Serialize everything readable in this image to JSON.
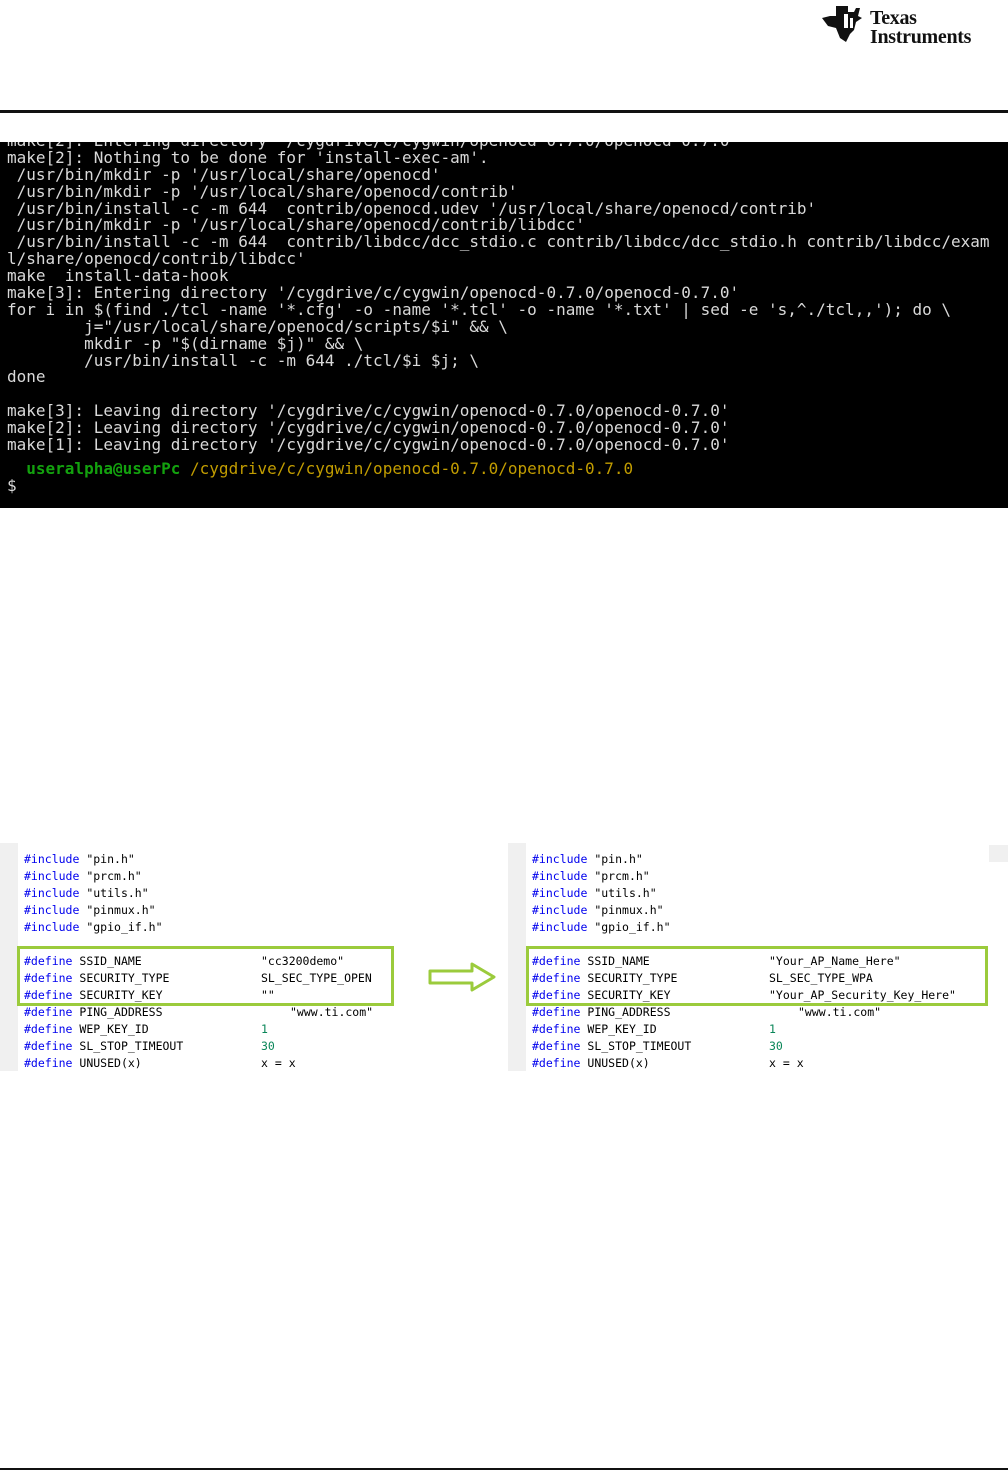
{
  "header": {
    "logo_line1": "Texas",
    "logo_line2": "Instruments",
    "logo_icon": "ti-state-bug-icon"
  },
  "terminal": {
    "lines": [
      "make[2]: Nothing to be done for 'install-exec-am'.",
      " /usr/bin/mkdir -p '/usr/local/share/openocd'",
      " /usr/bin/mkdir -p '/usr/local/share/openocd/contrib'",
      " /usr/bin/install -c -m 644  contrib/openocd.udev '/usr/local/share/openocd/contrib'",
      " /usr/bin/mkdir -p '/usr/local/share/openocd/contrib/libdcc'",
      " /usr/bin/install -c -m 644  contrib/libdcc/dcc_stdio.c contrib/libdcc/dcc_stdio.h contrib/libdcc/exam",
      "l/share/openocd/contrib/libdcc'",
      "make  install-data-hook",
      "make[3]: Entering directory '/cygdrive/c/cygwin/openocd-0.7.0/openocd-0.7.0'",
      "for i in $(find ./tcl -name '*.cfg' -o -name '*.tcl' -o -name '*.txt' | sed -e 's,^./tcl,,'); do \\",
      "        j=\"/usr/local/share/openocd/scripts/$i\" && \\",
      "        mkdir -p \"$(dirname $j)\" && \\",
      "        /usr/bin/install -c -m 644 ./tcl/$i $j; \\",
      "done",
      "",
      "make[3]: Leaving directory '/cygdrive/c/cygwin/openocd-0.7.0/openocd-0.7.0'",
      "make[2]: Leaving directory '/cygdrive/c/cygwin/openocd-0.7.0/openocd-0.7.0'",
      "make[1]: Leaving directory '/cygdrive/c/cygwin/openocd-0.7.0/openocd-0.7.0'"
    ],
    "prompt_user": "useralpha@userPc",
    "prompt_path": "/cygdrive/c/cygwin/openocd-0.7.0/openocd-0.7.0",
    "prompt_symbol": "$",
    "colors": {
      "background": "#000000",
      "text": "#d9d9d9",
      "user": "#13a10e",
      "path": "#c19c00"
    }
  },
  "code_before": {
    "includes": [
      {
        "kw": "#include",
        "val": "\"pin.h\""
      },
      {
        "kw": "#include",
        "val": "\"prcm.h\""
      },
      {
        "kw": "#include",
        "val": "\"utils.h\""
      },
      {
        "kw": "#include",
        "val": "\"pinmux.h\""
      },
      {
        "kw": "#include",
        "val": "\"gpio_if.h\""
      }
    ],
    "defines": [
      {
        "kw": "#define",
        "name": "SSID_NAME",
        "val": "\"cc3200demo\""
      },
      {
        "kw": "#define",
        "name": "SECURITY_TYPE",
        "val": "SL_SEC_TYPE_OPEN"
      },
      {
        "kw": "#define",
        "name": "SECURITY_KEY",
        "val": "\"\""
      },
      {
        "kw": "#define",
        "name": "PING_ADDRESS",
        "val": "\"www.ti.com\""
      },
      {
        "kw": "#define",
        "name": "WEP_KEY_ID",
        "val": "1"
      },
      {
        "kw": "#define",
        "name": "SL_STOP_TIMEOUT",
        "val": "30"
      },
      {
        "kw": "#define",
        "name": "UNUSED(x)",
        "val": "x = x"
      }
    ]
  },
  "code_after": {
    "includes": [
      {
        "kw": "#include",
        "val": "\"pin.h\""
      },
      {
        "kw": "#include",
        "val": "\"prcm.h\""
      },
      {
        "kw": "#include",
        "val": "\"utils.h\""
      },
      {
        "kw": "#include",
        "val": "\"pinmux.h\""
      },
      {
        "kw": "#include",
        "val": "\"gpio_if.h\""
      }
    ],
    "defines": [
      {
        "kw": "#define",
        "name": "SSID_NAME",
        "val": "\"Your_AP_Name_Here\""
      },
      {
        "kw": "#define",
        "name": "SECURITY_TYPE",
        "val": "SL_SEC_TYPE_WPA"
      },
      {
        "kw": "#define",
        "name": "SECURITY_KEY",
        "val": "\"Your_AP_Security_Key_Here\""
      },
      {
        "kw": "#define",
        "name": "PING_ADDRESS",
        "val": "\"www.ti.com\""
      },
      {
        "kw": "#define",
        "name": "WEP_KEY_ID",
        "val": "1"
      },
      {
        "kw": "#define",
        "name": "SL_STOP_TIMEOUT",
        "val": "30"
      },
      {
        "kw": "#define",
        "name": "UNUSED(x)",
        "val": "x = x"
      }
    ]
  },
  "accent": {
    "highlight_border": "#9bcb3c",
    "keyword": "#0000ee",
    "number": "#098658"
  },
  "arrow_icon": "right-arrow-icon"
}
